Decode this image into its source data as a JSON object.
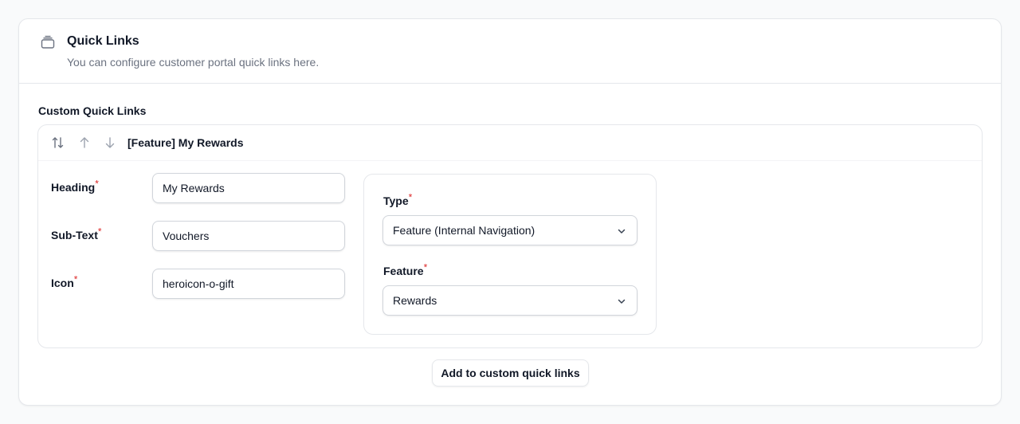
{
  "section": {
    "title": "Quick Links",
    "description": "You can configure customer portal quick links here."
  },
  "custom_quick_links": {
    "label": "Custom Quick Links",
    "item": {
      "title": "[Feature] My Rewards",
      "heading": {
        "label": "Heading",
        "value": "My Rewards"
      },
      "sub_text": {
        "label": "Sub-Text",
        "value": "Vouchers"
      },
      "icon": {
        "label": "Icon",
        "value": "heroicon-o-gift"
      },
      "type": {
        "label": "Type",
        "value": "Feature (Internal Navigation)"
      },
      "feature": {
        "label": "Feature",
        "value": "Rewards"
      }
    },
    "add_button_label": "Add to custom quick links"
  },
  "required_mark": "*",
  "colors": {
    "required": "#dc2626",
    "border": "#e5e7eb",
    "muted_text": "#6b7280",
    "icon": "#6b7280"
  },
  "icons": {
    "header": "rectangle-stack-icon",
    "reorder": "arrows-up-down-icon",
    "move_up": "arrow-up-icon",
    "move_down": "arrow-down-icon",
    "select_chevron": "chevron-down-icon"
  }
}
